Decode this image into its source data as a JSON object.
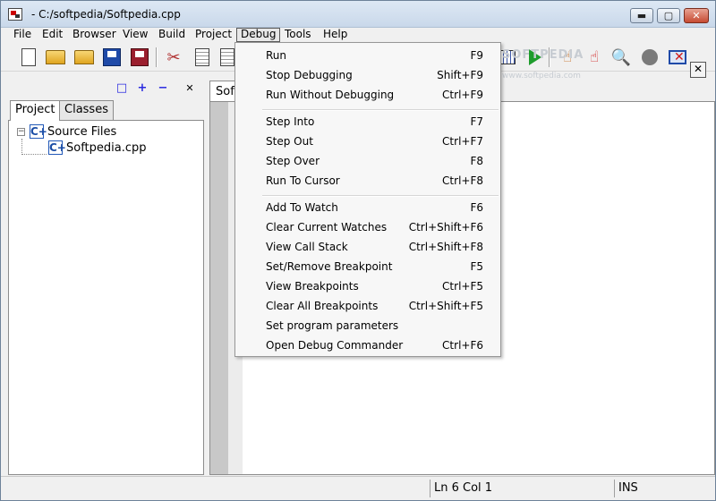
{
  "window": {
    "title": "- C:/softpedia/Softpedia.cpp",
    "controls": {
      "minimize": "▬",
      "maximize": "▢",
      "close": "✕"
    }
  },
  "menubar": {
    "items": [
      "File",
      "Edit",
      "Browser",
      "View",
      "Build",
      "Project",
      "Debug",
      "Tools",
      "Help"
    ],
    "open_item": "Debug"
  },
  "toolbar": {
    "icons": [
      "new-file-icon",
      "open-project-icon",
      "open-folder-icon",
      "save-icon",
      "save-all-icon",
      "cut-icon",
      "copy-icon",
      "paste-icon",
      "grid-icon",
      "run-icon",
      "hand-icon",
      "stop-hand-icon",
      "find-icon",
      "stop-icon",
      "close-monitor-icon"
    ],
    "cut_glyph": "✂",
    "hand_glyph": "☝",
    "find_glyph": "🔍"
  },
  "project_pane": {
    "tool_glyphs": {
      "window": "□",
      "plus": "+",
      "minus": "−",
      "close": "✕"
    },
    "tabs": [
      "Project",
      "Classes"
    ],
    "active_tab": "Project",
    "tree": {
      "expander": "−",
      "cpp_glyph": "C+",
      "folder": "Source Files",
      "files": [
        "Softpedia.cpp"
      ]
    }
  },
  "editor": {
    "tab_label": "Soft",
    "close_glyph": "✕",
    "watermark": "SOFTPEDIA",
    "watermark_sub": "www.softpedia.com"
  },
  "debug_menu": {
    "groups": [
      [
        {
          "label": "Run",
          "shortcut": "F9"
        },
        {
          "label": "Stop Debugging",
          "shortcut": "Shift+F9"
        },
        {
          "label": "Run Without Debugging",
          "shortcut": "Ctrl+F9"
        }
      ],
      [
        {
          "label": "Step Into",
          "shortcut": "F7"
        },
        {
          "label": "Step Out",
          "shortcut": "Ctrl+F7"
        },
        {
          "label": "Step Over",
          "shortcut": "F8"
        },
        {
          "label": "Run To Cursor",
          "shortcut": "Ctrl+F8"
        }
      ],
      [
        {
          "label": "Add To Watch",
          "shortcut": "F6"
        },
        {
          "label": "Clear Current Watches",
          "shortcut": "Ctrl+Shift+F6"
        },
        {
          "label": "View Call Stack",
          "shortcut": "Ctrl+Shift+F8"
        },
        {
          "label": "Set/Remove Breakpoint",
          "shortcut": "F5"
        },
        {
          "label": "View Breakpoints",
          "shortcut": "Ctrl+F5"
        },
        {
          "label": "Clear All Breakpoints",
          "shortcut": "Ctrl+Shift+F5"
        },
        {
          "label": "Set program parameters",
          "shortcut": ""
        },
        {
          "label": "Open Debug Commander",
          "shortcut": "Ctrl+F6"
        }
      ]
    ]
  },
  "statusbar": {
    "line": "Ln 6",
    "col": "Col 1",
    "mode": "INS"
  }
}
